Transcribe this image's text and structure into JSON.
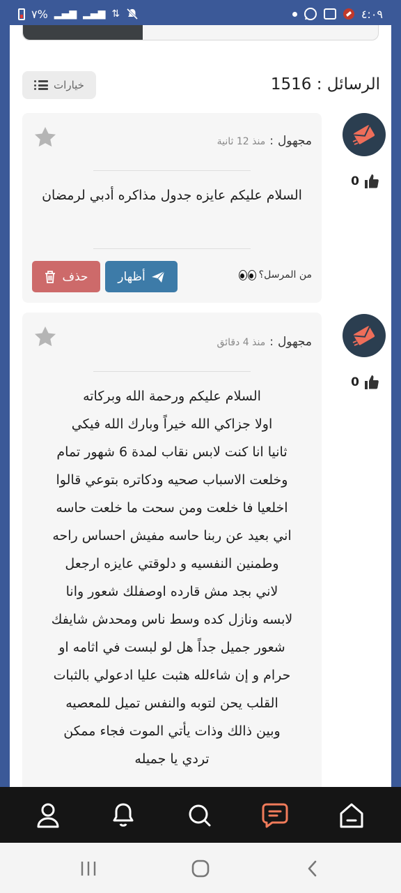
{
  "status_bar": {
    "time": "٤:٠٩",
    "battery": "٧%",
    "icons": [
      "battery-icon",
      "signal-icon",
      "signal-icon",
      "data-arrows-icon",
      "mute-icon",
      "notification-dot-icon",
      "whatsapp-icon",
      "gallery-icon",
      "app-icon"
    ]
  },
  "header": {
    "messages_label": "الرسائل : 1516",
    "options_label": "خيارات"
  },
  "messages": [
    {
      "sender": "مجهول",
      "time": "منذ 12 ثانية",
      "text": "السلام عليكم عايزه جدول مذاكره أدبي لرمضان",
      "likes": "0",
      "sender_question": "من المرسل؟",
      "show_label": "أظهار",
      "delete_label": "حذف"
    },
    {
      "sender": "مجهول",
      "time": "منذ 4 دقائق",
      "text": "السلام عليكم ورحمة الله وبركاته\nاولا جزاكي الله خيراً وبارك الله فيكي\nثانيا انا كنت لابس نقاب لمدة 6 شهور تمام\nوخلعت الاسباب صحيه ودكاتره بتوعي قالوا\nاخلعيا فا خلعت ومن سحت ما خلعت حاسه\nاني بعيد عن ربنا حاسه مفيش احساس راحه\nوطمنين النفسيه و دلوقتي عايزه ارجعل\nلاني بجد مش قارده اوصفلك شعور وانا\nلابسه ونازل كده وسط ناس ومحدش شايفك\nشعور جميل جداً هل لو لبست في اثامه او\nحرام و إن شاءلله هثبت عليا ادعولي بالثبات\nالقلب يحن لتوبه والنفس تميل للمعصيه\nوبين ذالك وذات يأتي الموت فجاء ممكن\nتردي يا جميله",
      "likes": "0"
    }
  ],
  "bottom_nav": [
    "profile-icon",
    "bell-icon",
    "search-icon",
    "messages-icon",
    "home-icon"
  ],
  "colors": {
    "brand": "#3b5998",
    "show_button": "#3d7ba8",
    "delete_button": "#cd6a6a",
    "active_nav": "#f07b5a",
    "avatar_bg": "#2b3e50",
    "avatar_accent": "#ee6e5a"
  }
}
